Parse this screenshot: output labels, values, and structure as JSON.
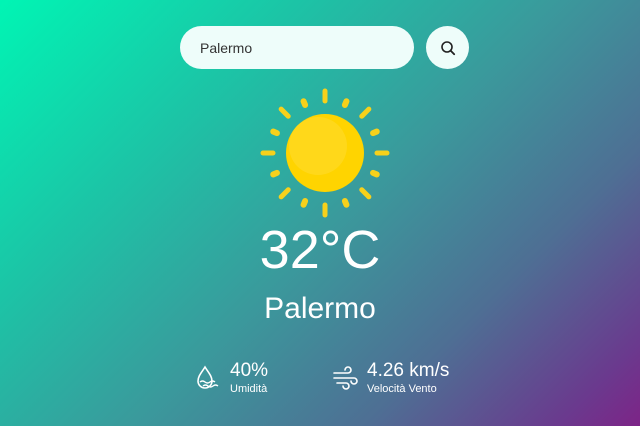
{
  "search": {
    "value": "Palermo",
    "icon": "search-icon"
  },
  "weather": {
    "icon": "sun-icon",
    "temperature": "32°C",
    "city": "Palermo"
  },
  "details": {
    "humidity": {
      "icon": "humidity-icon",
      "value": "40%",
      "label": "Umidità"
    },
    "wind": {
      "icon": "wind-icon",
      "value": "4.26 km/s",
      "label": "Velocità Vento"
    }
  },
  "colors": {
    "gradient_start": "#00f5b4",
    "gradient_end": "#7d2487",
    "sun": "#ffd400",
    "sun_rays": "#f7d11b",
    "search_bg": "#eefdfa"
  }
}
